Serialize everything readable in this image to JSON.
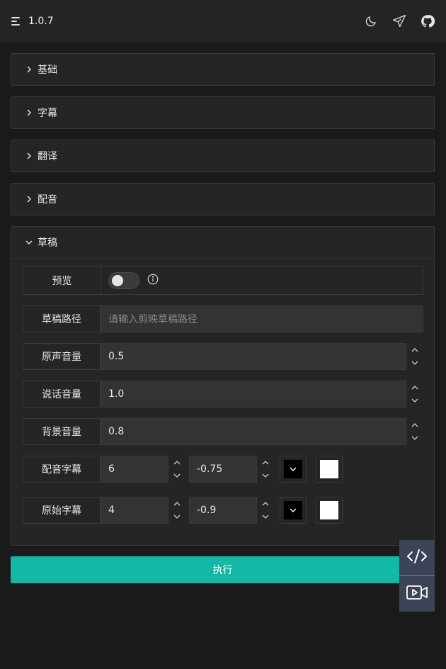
{
  "header": {
    "version": "1.0.7",
    "icons": [
      "menu-icon",
      "moon-icon",
      "send-icon",
      "github-icon"
    ]
  },
  "sections": [
    {
      "label": "基础",
      "expanded": false
    },
    {
      "label": "字幕",
      "expanded": false
    },
    {
      "label": "翻译",
      "expanded": false
    },
    {
      "label": "配音",
      "expanded": false
    },
    {
      "label": "草稿",
      "expanded": true
    }
  ],
  "draft": {
    "preview": {
      "label": "预览",
      "enabled": false
    },
    "path": {
      "label": "草稿路径",
      "placeholder": "请输入剪映草稿路径",
      "value": ""
    },
    "original_volume": {
      "label": "原声音量",
      "value": "0.5"
    },
    "speech_volume": {
      "label": "说话音量",
      "value": "1.0"
    },
    "bg_volume": {
      "label": "背景音量",
      "value": "0.8"
    },
    "dub_subtitle": {
      "label": "配音字幕",
      "size": "6",
      "offset": "-0.75",
      "color1": "#000000",
      "color2": "#ffffff"
    },
    "orig_subtitle": {
      "label": "原始字幕",
      "size": "4",
      "offset": "-0.9",
      "color1": "#000000",
      "color2": "#ffffff"
    }
  },
  "execute_label": "执行",
  "colors": {
    "accent": "#14b8a6",
    "float_bg": "#3d4457"
  }
}
